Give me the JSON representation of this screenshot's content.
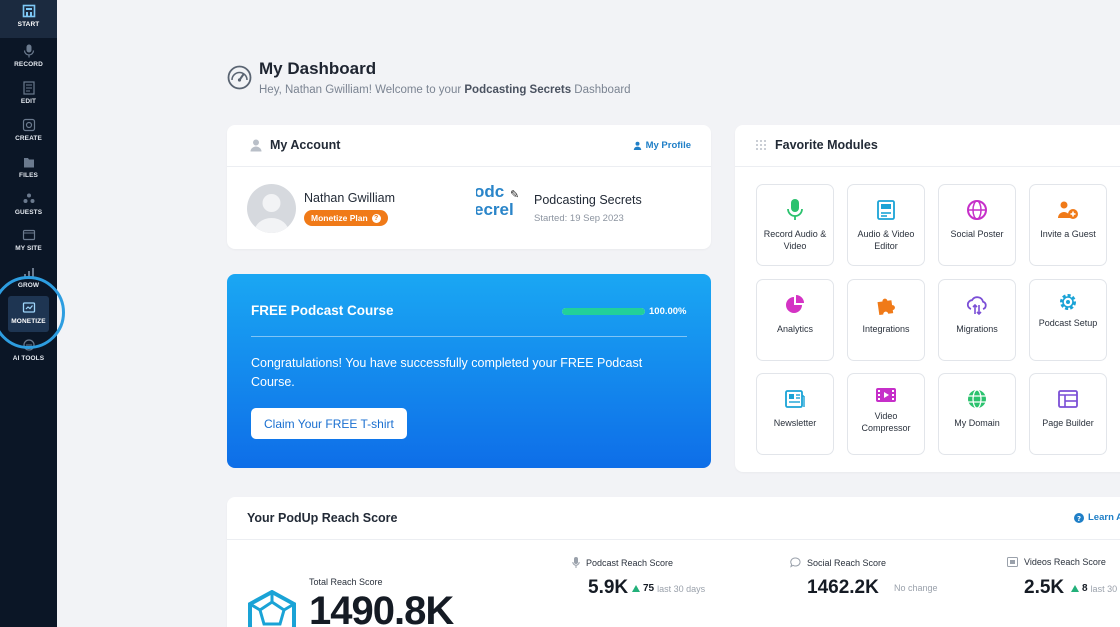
{
  "sidebar": {
    "items": [
      {
        "label": "START",
        "icon": "start-icon"
      },
      {
        "label": "RECORD",
        "icon": "microphone-icon"
      },
      {
        "label": "EDIT",
        "icon": "edit-icon"
      },
      {
        "label": "CREATE",
        "icon": "create-icon"
      },
      {
        "label": "FILES",
        "icon": "files-icon"
      },
      {
        "label": "GUESTS",
        "icon": "guests-icon"
      },
      {
        "label": "MY SITE",
        "icon": "site-icon"
      },
      {
        "label": "GROW",
        "icon": "grow-icon"
      },
      {
        "label": "MONETIZE",
        "icon": "monetize-icon"
      },
      {
        "label": "AI TOOLS",
        "icon": "ai-tools-icon"
      }
    ]
  },
  "header": {
    "title": "My Dashboard",
    "subtitle_prefix": "Hey, Nathan Gwilliam! Welcome to your ",
    "subtitle_bold": "Podcasting Secrets",
    "subtitle_suffix": " Dashboard"
  },
  "account": {
    "title": "My Account",
    "profile_link": "My Profile",
    "user_name": "Nathan Gwilliam",
    "plan": "Monetize Plan",
    "podcast_logo_text": "odc\necrel",
    "podcast_name": "Podcasting Secrets",
    "podcast_started": "Started: 19 Sep 2023"
  },
  "course": {
    "title": "FREE Podcast Course",
    "progress": 100,
    "progress_text": "100.00%",
    "message": "Congratulations! You have successfully completed your FREE Podcast Course.",
    "button": "Claim Your FREE T-shirt"
  },
  "favorites": {
    "title": "Favorite Modules",
    "modules": [
      {
        "label": "Record Audio & Video",
        "icon": "microphone-icon",
        "color": "#2bc26e"
      },
      {
        "label": "Audio & Video Editor",
        "icon": "editor-icon",
        "color": "#1aa3d6"
      },
      {
        "label": "Social Poster",
        "icon": "social-globe-icon",
        "color": "#c62fc9"
      },
      {
        "label": "Invite a Guest",
        "icon": "invite-guest-icon",
        "color": "#f07a18"
      },
      {
        "label": "Analytics",
        "icon": "pie-chart-icon",
        "color": "#d433c4"
      },
      {
        "label": "Integrations",
        "icon": "puzzle-icon",
        "color": "#f07a18"
      },
      {
        "label": "Migrations",
        "icon": "cloud-migrate-icon",
        "color": "#7b4fd6"
      },
      {
        "label": "Podcast Setup",
        "icon": "gear-icon",
        "color": "#1aa3d6"
      },
      {
        "label": "Newsletter",
        "icon": "newsletter-icon",
        "color": "#1aa3d6"
      },
      {
        "label": "Video Compressor",
        "icon": "video-compress-icon",
        "color": "#c62fc9"
      },
      {
        "label": "My Domain",
        "icon": "domain-globe-icon",
        "color": "#2bc26e"
      },
      {
        "label": "Page Builder",
        "icon": "page-builder-icon",
        "color": "#7b4fd6"
      }
    ]
  },
  "reach": {
    "title": "Your PodUp Reach Score",
    "learn": "Learn A",
    "total_label": "Total Reach Score",
    "total_value": "1490.8K",
    "metrics": [
      {
        "label": "Podcast Reach Score",
        "value": "5.9K",
        "delta": "75",
        "delta_text": "last 30 days",
        "icon": "microphone-icon"
      },
      {
        "label": "Social Reach Score",
        "value": "1462.2K",
        "delta": "",
        "delta_text": "No change",
        "icon": "chat-icon"
      },
      {
        "label": "Videos Reach Score",
        "value": "2.5K",
        "delta": "8",
        "delta_text": "last 30",
        "icon": "video-icon"
      }
    ]
  }
}
